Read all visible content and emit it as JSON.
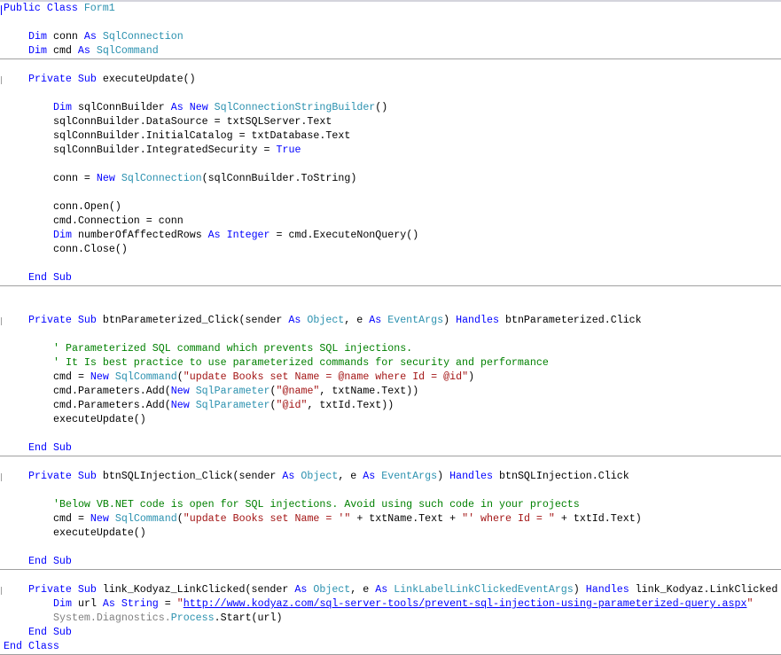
{
  "colors": {
    "keyword": "#0000ff",
    "type": "#2b91af",
    "string": "#a31515",
    "comment": "#008000",
    "namespace": "#808080"
  },
  "lines": [
    {
      "n": 0,
      "indent": 0,
      "tokens": [
        [
          "kw",
          "Public Class "
        ],
        [
          "ty",
          "Form1"
        ]
      ]
    },
    {
      "n": 2,
      "indent": 4,
      "tokens": [
        [
          "kw",
          "Dim"
        ],
        [
          "",
          "conn "
        ],
        [
          "kw",
          "As "
        ],
        [
          "ty",
          "SqlConnection"
        ]
      ]
    },
    {
      "n": 3,
      "indent": 4,
      "tokens": [
        [
          "kw",
          "Dim"
        ],
        [
          "",
          "cmd "
        ],
        [
          "kw",
          "As "
        ],
        [
          "ty",
          "SqlCommand"
        ]
      ]
    },
    {
      "n": 5,
      "indent": 4,
      "tokens": [
        [
          "kw",
          "Private Sub "
        ],
        [
          "",
          "executeUpdate()"
        ]
      ]
    },
    {
      "n": 7,
      "indent": 8,
      "tokens": [
        [
          "kw",
          "Dim"
        ],
        [
          "",
          "sqlConnBuilder "
        ],
        [
          "kw",
          "As New "
        ],
        [
          "ty",
          "SqlConnectionStringBuilder"
        ],
        [
          "",
          "()"
        ]
      ]
    },
    {
      "n": 8,
      "indent": 8,
      "tokens": [
        [
          "",
          "sqlConnBuilder.DataSource = txtSQLServer.Text"
        ]
      ]
    },
    {
      "n": 9,
      "indent": 8,
      "tokens": [
        [
          "",
          "sqlConnBuilder.InitialCatalog = txtDatabase.Text"
        ]
      ]
    },
    {
      "n": 10,
      "indent": 8,
      "tokens": [
        [
          "",
          "sqlConnBuilder.IntegratedSecurity = "
        ],
        [
          "kw",
          "True"
        ]
      ]
    },
    {
      "n": 12,
      "indent": 8,
      "tokens": [
        [
          "",
          "conn = "
        ],
        [
          "kw",
          "New "
        ],
        [
          "ty",
          "SqlConnection"
        ],
        [
          "",
          "(sqlConnBuilder.ToString)"
        ]
      ]
    },
    {
      "n": 14,
      "indent": 8,
      "tokens": [
        [
          "",
          "conn.Open()"
        ]
      ]
    },
    {
      "n": 15,
      "indent": 8,
      "tokens": [
        [
          "",
          "cmd.Connection = conn"
        ]
      ]
    },
    {
      "n": 16,
      "indent": 8,
      "tokens": [
        [
          "kw",
          "Dim"
        ],
        [
          "",
          "numberOfAffectedRows "
        ],
        [
          "kw",
          "As Integer"
        ],
        [
          "",
          " = cmd.ExecuteNonQuery()"
        ]
      ]
    },
    {
      "n": 17,
      "indent": 8,
      "tokens": [
        [
          "",
          "conn.Close()"
        ]
      ]
    },
    {
      "n": 19,
      "indent": 4,
      "tokens": [
        [
          "kw",
          "End Sub"
        ]
      ]
    },
    {
      "n": 22,
      "indent": 4,
      "tokens": [
        [
          "kw",
          "Private Sub "
        ],
        [
          "",
          "btnParameterized_Click(sender "
        ],
        [
          "kw",
          "As "
        ],
        [
          "ty",
          "Object"
        ],
        [
          "",
          ", e "
        ],
        [
          "kw",
          "As "
        ],
        [
          "ty",
          "EventArgs"
        ],
        [
          "",
          ") "
        ],
        [
          "kw",
          "Handles "
        ],
        [
          "",
          "btnParameterized.Click"
        ]
      ]
    },
    {
      "n": 24,
      "indent": 8,
      "tokens": [
        [
          "cm",
          "' Parameterized SQL command which prevents SQL injections."
        ]
      ]
    },
    {
      "n": 25,
      "indent": 8,
      "tokens": [
        [
          "cm",
          "' It Is best practice to use parameterized commands for security and performance"
        ]
      ]
    },
    {
      "n": 26,
      "indent": 8,
      "tokens": [
        [
          "",
          "cmd = "
        ],
        [
          "kw",
          "New "
        ],
        [
          "ty",
          "SqlCommand"
        ],
        [
          "",
          "("
        ],
        [
          "st",
          "\"update Books set Name = @name where Id = @id\""
        ],
        [
          "",
          ")"
        ]
      ]
    },
    {
      "n": 27,
      "indent": 8,
      "tokens": [
        [
          "",
          "cmd.Parameters.Add("
        ],
        [
          "kw",
          "New "
        ],
        [
          "ty",
          "SqlParameter"
        ],
        [
          "",
          "("
        ],
        [
          "st",
          "\"@name\""
        ],
        [
          "",
          ", txtName.Text))"
        ]
      ]
    },
    {
      "n": 28,
      "indent": 8,
      "tokens": [
        [
          "",
          "cmd.Parameters.Add("
        ],
        [
          "kw",
          "New "
        ],
        [
          "ty",
          "SqlParameter"
        ],
        [
          "",
          "("
        ],
        [
          "st",
          "\"@id\""
        ],
        [
          "",
          ", txtId.Text))"
        ]
      ]
    },
    {
      "n": 29,
      "indent": 8,
      "tokens": [
        [
          "",
          "executeUpdate()"
        ]
      ]
    },
    {
      "n": 31,
      "indent": 4,
      "tokens": [
        [
          "kw",
          "End Sub"
        ]
      ]
    },
    {
      "n": 33,
      "indent": 4,
      "tokens": [
        [
          "kw",
          "Private Sub "
        ],
        [
          "",
          "btnSQLInjection_Click(sender "
        ],
        [
          "kw",
          "As "
        ],
        [
          "ty",
          "Object"
        ],
        [
          "",
          ", e "
        ],
        [
          "kw",
          "As "
        ],
        [
          "ty",
          "EventArgs"
        ],
        [
          "",
          ") "
        ],
        [
          "kw",
          "Handles "
        ],
        [
          "",
          "btnSQLInjection.Click"
        ]
      ]
    },
    {
      "n": 35,
      "indent": 8,
      "tokens": [
        [
          "cm",
          "'Below VB.NET code is open for SQL injections. Avoid using such code in your projects"
        ]
      ]
    },
    {
      "n": 36,
      "indent": 8,
      "tokens": [
        [
          "",
          "cmd = "
        ],
        [
          "kw",
          "New "
        ],
        [
          "ty",
          "SqlCommand"
        ],
        [
          "",
          "("
        ],
        [
          "st",
          "\"update Books set Name = '\""
        ],
        [
          "",
          " + txtName.Text + "
        ],
        [
          "st",
          "\"' where Id = \""
        ],
        [
          "",
          " + txtId.Text)"
        ]
      ]
    },
    {
      "n": 37,
      "indent": 8,
      "tokens": [
        [
          "",
          "executeUpdate()"
        ]
      ]
    },
    {
      "n": 39,
      "indent": 4,
      "tokens": [
        [
          "kw",
          "End Sub"
        ]
      ]
    },
    {
      "n": 41,
      "indent": 4,
      "tokens": [
        [
          "kw",
          "Private Sub "
        ],
        [
          "",
          "link_Kodyaz_LinkClicked(sender "
        ],
        [
          "kw",
          "As "
        ],
        [
          "ty",
          "Object"
        ],
        [
          "",
          ", e "
        ],
        [
          "kw",
          "As "
        ],
        [
          "ty",
          "LinkLabelLinkClickedEventArgs"
        ],
        [
          "",
          ") "
        ],
        [
          "kw",
          "Handles "
        ],
        [
          "",
          "link_Kodyaz.LinkClicked"
        ]
      ]
    },
    {
      "n": 42,
      "indent": 8,
      "tokens": [
        [
          "kw",
          "Dim"
        ],
        [
          "",
          "url "
        ],
        [
          "kw",
          "As String"
        ],
        [
          "",
          " = "
        ],
        [
          "st",
          "\""
        ],
        [
          "ln",
          "http://www.kodyaz.com/sql-server-tools/prevent-sql-injection-using-parameterized-query.aspx"
        ],
        [
          "st",
          "\""
        ]
      ]
    },
    {
      "n": 43,
      "indent": 8,
      "tokens": [
        [
          "gr",
          "System.Diagnostics."
        ],
        [
          "ty",
          "Process"
        ],
        [
          "",
          ".Start(url)"
        ]
      ]
    },
    {
      "n": 44,
      "indent": 4,
      "tokens": [
        [
          "kw",
          "End Sub"
        ]
      ]
    },
    {
      "n": 45,
      "indent": 0,
      "tokens": [
        [
          "kw",
          "End Class"
        ]
      ]
    }
  ]
}
